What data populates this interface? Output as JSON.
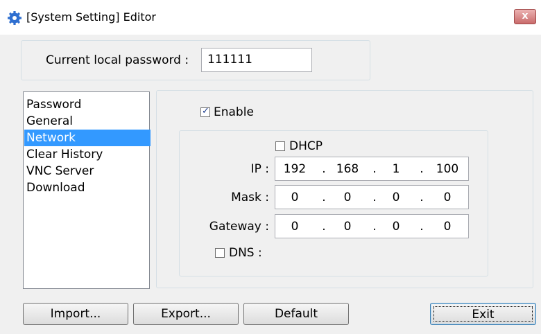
{
  "window": {
    "title": "[System Setting] Editor",
    "title_icon": "gear-icon",
    "close_label": "x"
  },
  "password": {
    "label": "Current local password :",
    "value": "111111"
  },
  "nav": {
    "items": [
      {
        "label": "Password"
      },
      {
        "label": "General"
      },
      {
        "label": "Network",
        "selected": true
      },
      {
        "label": "Clear History"
      },
      {
        "label": "VNC Server"
      },
      {
        "label": "Download"
      }
    ]
  },
  "network": {
    "enable": {
      "label": "Enable",
      "checked": true
    },
    "dhcp": {
      "label": "DHCP",
      "checked": false
    },
    "ip": {
      "label": "IP :",
      "octets": [
        "192",
        "168",
        "1",
        "100"
      ]
    },
    "mask": {
      "label": "Mask :",
      "octets": [
        "0",
        "0",
        "0",
        "0"
      ]
    },
    "gateway": {
      "label": "Gateway :",
      "octets": [
        "0",
        "0",
        "0",
        "0"
      ]
    },
    "dns": {
      "label": "DNS :",
      "checked": false
    },
    "separator": "."
  },
  "buttons": {
    "import": "Import...",
    "export": "Export...",
    "default": "Default",
    "exit": "Exit"
  },
  "colors": {
    "selection": "#3399ff",
    "close_button": "#c96b6b",
    "dialog_bg": "#f0f0f0"
  }
}
